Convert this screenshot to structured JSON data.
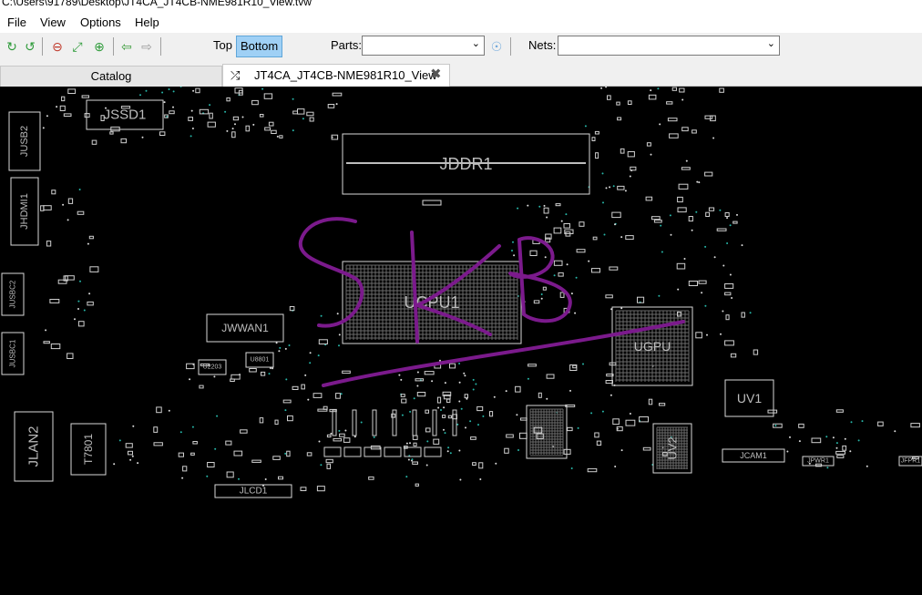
{
  "window": {
    "title": "C:\\Users\\91789\\Desktop\\JT4CA_JT4CB-NME981R10_View.tvw"
  },
  "menu": [
    "File",
    "View",
    "Options",
    "Help"
  ],
  "toolbar": {
    "icons": [
      "refresh-icon",
      "reload-icon",
      "zoom-out-icon",
      "fit-icon",
      "zoom-in-icon",
      "back-icon",
      "forward-icon"
    ],
    "top_label": "Top",
    "bottom_label": "Bottom",
    "parts_label": "Parts:",
    "parts_value": "",
    "nets_label": "Nets:",
    "nets_value": ""
  },
  "tabs": {
    "catalog": "Catalog",
    "view": "JT4CA_JT4CB-NME981R10_View"
  },
  "board": {
    "components": [
      "JSSD1",
      "JUSB2",
      "JHDMI1",
      "JUSBC2",
      "JUSBC1",
      "JDDR1",
      "UCPU1",
      "JWWAN1",
      "U2203",
      "U8801",
      "UGPU",
      "UV1",
      "UV2",
      "JCAM1",
      "JPWR1",
      "JFPR1",
      "JLAN2",
      "T7801",
      "JLCD1"
    ],
    "annotation": "SKB",
    "annotation_color": "#7b1a8c"
  }
}
